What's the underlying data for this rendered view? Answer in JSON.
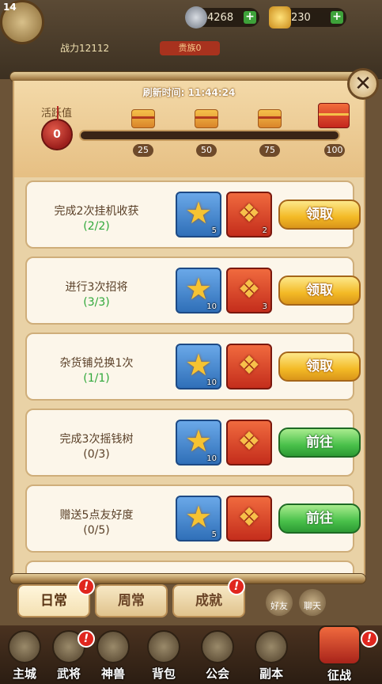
{
  "hud": {
    "level": "14",
    "silver": "4268",
    "gold": "230",
    "power": "战力12112",
    "noble": "贵族0"
  },
  "panel": {
    "refresh_time": "刷新时间: 11:44:24",
    "activity_label": "活跃值",
    "activity_value": "0",
    "activity_progress": 0,
    "milestones": [
      "25",
      "50",
      "75",
      "100"
    ]
  },
  "tasks": [
    {
      "name": "完成2次挂机收获",
      "progress": "(2/2)",
      "star_qty": "5",
      "gift_qty": "2",
      "action": "领取"
    },
    {
      "name": "进行3次招将",
      "progress": "(3/3)",
      "star_qty": "10",
      "gift_qty": "3",
      "action": "领取"
    },
    {
      "name": "杂货铺兑换1次",
      "progress": "(1/1)",
      "star_qty": "10",
      "gift_qty": "",
      "action": "领取"
    },
    {
      "name": "完成3次摇钱树",
      "progress": "(0/3)",
      "star_qty": "10",
      "gift_qty": "",
      "action": "前往"
    },
    {
      "name": "赠送5点友好度",
      "progress": "(0/5)",
      "star_qty": "5",
      "gift_qty": "",
      "action": "前往"
    }
  ],
  "tabs": [
    "日常",
    "周常",
    "成就"
  ],
  "side_chips": [
    "好友",
    "聊天"
  ],
  "bottom_nav": [
    "主城",
    "武将",
    "神兽",
    "背包",
    "公会",
    "副本",
    "征战"
  ],
  "colors": {
    "done_progress": "#2fa83a",
    "claim_button": "#f3b925",
    "go_button": "#49c04a",
    "alert": "#e0261e"
  }
}
